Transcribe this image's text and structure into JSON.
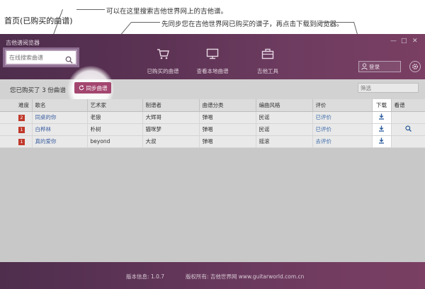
{
  "annotation": {
    "page_label": "首页(已购买的曲谱)",
    "note_search": "可以在这里搜索吉他世界网上的吉他谱。",
    "note_sync": "先同步您在吉他世界网已购买的谱子，再点击下载到阅览器。"
  },
  "app": {
    "title": "吉他谱阅览器",
    "controls": {
      "min": "—",
      "max": "□",
      "close": "✕"
    }
  },
  "search": {
    "placeholder": "在线搜索曲谱",
    "value": ""
  },
  "nav": [
    {
      "label": "已购买的曲谱",
      "icon": "cart-icon"
    },
    {
      "label": "查看本地曲谱",
      "icon": "monitor-icon"
    },
    {
      "label": "吉他工具",
      "icon": "toolbox-icon"
    }
  ],
  "login": {
    "label": "登录",
    "icon": "user-icon"
  },
  "toolbar": {
    "summary": "您已购买了 3 份曲谱",
    "sync_label": "同步曲谱",
    "filter_placeholder": "筛选"
  },
  "table": {
    "headers": [
      "难度",
      "歌名",
      "艺术家",
      "制谱者",
      "曲谱分类",
      "编曲风格",
      "评价",
      "下载",
      "看谱"
    ],
    "rows": [
      {
        "difficulty": "2",
        "name": "同桌的你",
        "artist": "老狼",
        "maker": "大辉哥",
        "category": "弹唱",
        "style": "民谣",
        "rating": "已评价",
        "view": false
      },
      {
        "difficulty": "1",
        "name": "白桦林",
        "artist": "朴树",
        "maker": "猫咪梦",
        "category": "弹唱",
        "style": "民谣",
        "rating": "已评价",
        "view": true
      },
      {
        "difficulty": "1",
        "name": "真的爱你",
        "artist": "beyond",
        "maker": "大叔",
        "category": "弹唱",
        "style": "摇滚",
        "rating": "去评价",
        "view": false
      }
    ]
  },
  "footer": {
    "version": "版本信息: 1.0.7",
    "copyright": "版权所有: 吉他世界网 www.guitarworld.com.cn"
  },
  "colors": {
    "header": "#5b3253",
    "accent": "#a3466f",
    "link": "#3b5ea0",
    "difficulty": "#c0392b"
  }
}
